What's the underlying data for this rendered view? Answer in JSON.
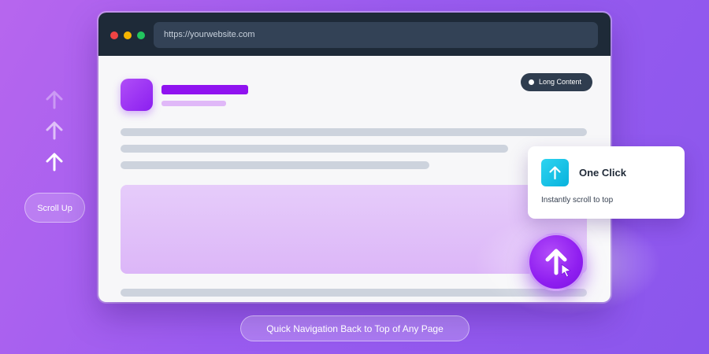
{
  "browser": {
    "url": "https://yourwebsite.com",
    "badge_label": "Long Content"
  },
  "side": {
    "scroll_up_label": "Scroll Up"
  },
  "card": {
    "title": "One Click",
    "text": "Instantly scroll to top"
  },
  "caption": "Quick Navigation Back to Top of Any Page",
  "colors": {
    "background": "#9b5cf0",
    "accent_purple": "#9013f0",
    "card_icon": "#08b2dd",
    "titlebar": "#1e2a38"
  },
  "icons": {
    "left_arrows": [
      "arrow-up-icon",
      "arrow-up-icon",
      "arrow-up-icon"
    ],
    "card_icon": "arrow-up-icon",
    "fab_icon": "arrow-up-icon",
    "cursor": "cursor-icon"
  }
}
